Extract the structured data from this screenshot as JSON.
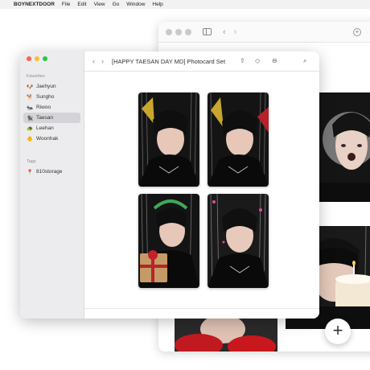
{
  "menubar": {
    "apple": "",
    "app_name": "BOYNEXTDOOR",
    "items": [
      "File",
      "Edit",
      "View",
      "Go",
      "Window",
      "Help"
    ]
  },
  "finder": {
    "title": "[HAPPY TAESAN DAY MD] Photocard Set",
    "sidebar": {
      "favorites_title": "Favorites",
      "favorites": [
        {
          "label": "Jaehyun",
          "emoji": "🐶"
        },
        {
          "label": "Sungho",
          "emoji": "🐕"
        },
        {
          "label": "Riwoo",
          "emoji": "🐜"
        },
        {
          "label": "Taesan",
          "emoji": "🐈‍⬛",
          "selected": true
        },
        {
          "label": "Leehan",
          "emoji": "🐢"
        },
        {
          "label": "Woonhak",
          "emoji": "🐥"
        }
      ],
      "tags_title": "Tags",
      "tags": [
        {
          "label": "810storage",
          "emoji": "📍"
        }
      ]
    },
    "photos": [
      {
        "name": "photocard-1"
      },
      {
        "name": "photocard-2"
      },
      {
        "name": "photocard-3"
      },
      {
        "name": "photocard-4"
      }
    ]
  },
  "icons": {
    "share": "⇪",
    "tag": "◇",
    "more": "⊖",
    "search": "⌕",
    "back": "‹",
    "forward": "›",
    "add": "+"
  },
  "colors": {
    "close": "#ff5f57",
    "minimize": "#febc2e",
    "zoom": "#28c840",
    "sidebar_selected": "#d4d4d8"
  }
}
